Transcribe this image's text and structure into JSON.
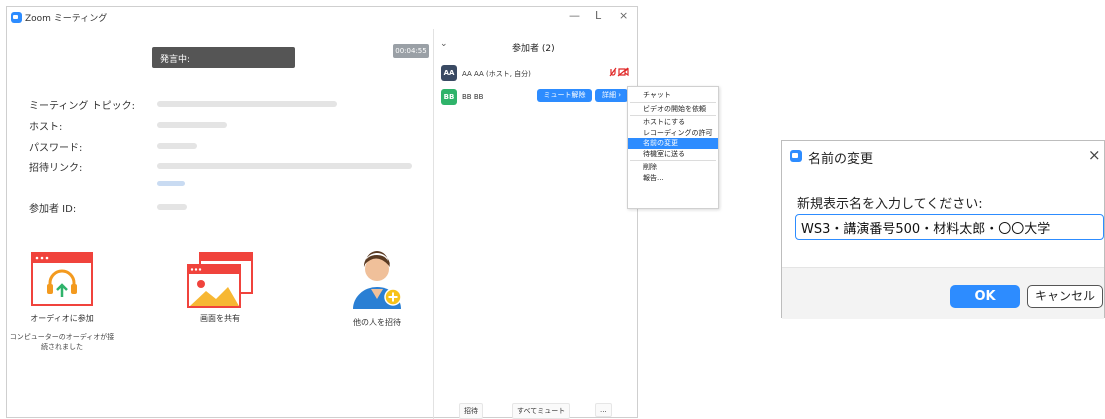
{
  "window": {
    "title": "Zoom ミーティング",
    "minimize": "—",
    "restore": "L",
    "close": "×"
  },
  "meeting": {
    "recording_label": "発言中:",
    "timer": "00:04:55",
    "info": [
      {
        "label": "ミーティング トピック:"
      },
      {
        "label": "ホスト:"
      },
      {
        "label": "パスワード:"
      },
      {
        "label": "招待リンク:"
      },
      {
        "label": "参加者 ID:"
      }
    ],
    "actions": {
      "audio": {
        "label": "オーディオに参加",
        "sub_line1": "コンピューターのオーディオが接",
        "sub_line2": "続されました"
      },
      "share": {
        "label": "画面を共有"
      },
      "invite": {
        "label": "他の人を招待"
      }
    }
  },
  "participants": {
    "chevron": "⌄",
    "title": "参加者 (2)",
    "rows": [
      {
        "initials": "AA",
        "name": "AA AA (ホスト, 自分)",
        "avatar_color": "#3a4a63"
      },
      {
        "initials": "BB",
        "name": "BB BB",
        "avatar_color": "#2fb36a"
      }
    ],
    "unmute_label": "ミュート解除",
    "more_label": "詳細 ›",
    "bottom": {
      "invite": "招待",
      "mute_all": "すべてミュート",
      "more": "..."
    }
  },
  "context_menu": {
    "items": [
      "チャット",
      "ビデオの開始を依頼",
      "ホストにする",
      "レコーディングの許可",
      "名前の変更",
      "待機室に送る",
      "削除",
      "報告..."
    ],
    "highlight_color": "#2d8cff"
  },
  "dialog": {
    "title": "名前の変更",
    "close": "×",
    "prompt": "新規表示名を入力してください:",
    "input_value": "WS3・講演番号500・材料太郎・〇〇大学",
    "ok": "OK",
    "cancel": "キャンセル"
  }
}
